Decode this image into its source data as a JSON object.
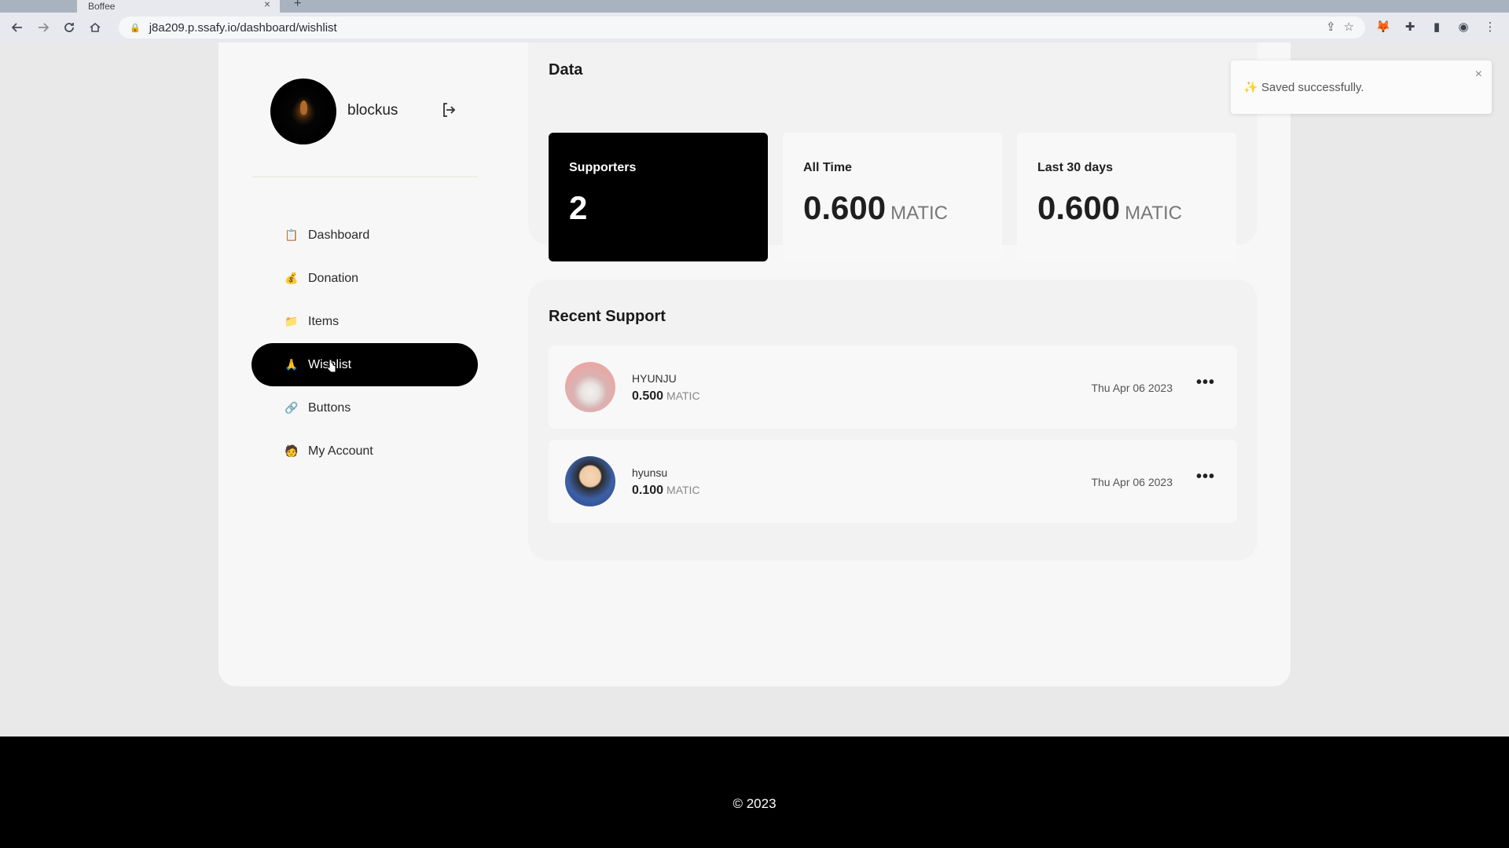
{
  "browser": {
    "tab_title": "Boffee",
    "tab_close": "×",
    "new_tab": "+",
    "url": "j8a209.p.ssafy.io/dashboard/wishlist"
  },
  "sidebar": {
    "username": "blockus",
    "items": [
      {
        "label": "Dashboard",
        "icon": "📋"
      },
      {
        "label": "Donation",
        "icon": "💰"
      },
      {
        "label": "Items",
        "icon": "📁"
      },
      {
        "label": "Wishlist",
        "icon": "🙏"
      },
      {
        "label": "Buttons",
        "icon": "🔗"
      },
      {
        "label": "My Account",
        "icon": "🧑"
      }
    ],
    "active_item": "Wishlist"
  },
  "data_section": {
    "title": "Data",
    "stats": [
      {
        "label": "Supporters",
        "value": "2",
        "unit": ""
      },
      {
        "label": "All Time",
        "value": "0.600",
        "unit": "MATIC"
      },
      {
        "label": "Last 30 days",
        "value": "0.600",
        "unit": "MATIC"
      }
    ]
  },
  "recent_support": {
    "title": "Recent Support",
    "rows": [
      {
        "name": "HYUNJU",
        "amount": "0.500",
        "unit": "MATIC",
        "date": "Thu Apr 06 2023",
        "more": "•••"
      },
      {
        "name": "hyunsu",
        "amount": "0.100",
        "unit": "MATIC",
        "date": "Thu Apr 06 2023",
        "more": "•••"
      }
    ]
  },
  "toast": {
    "message": "✨ Saved successfully.",
    "close": "×"
  },
  "footer": {
    "copyright": "© 2023"
  },
  "colors": {
    "active_bg": "#000000",
    "panel_bg": "#f7f7f7",
    "card_bg": "#f2f2f2"
  }
}
